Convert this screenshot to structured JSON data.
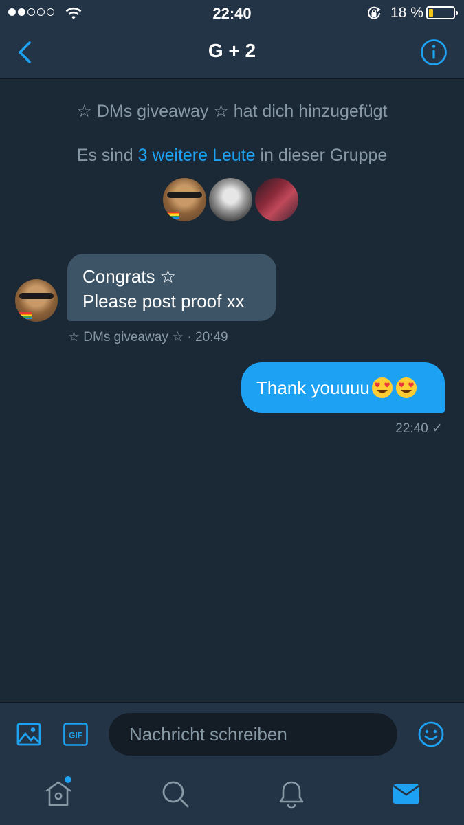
{
  "status_bar": {
    "time": "22:40",
    "battery_percent_label": "18 %",
    "battery_level": 0.18,
    "signal_bars_filled": 2,
    "signal_bars_total": 5
  },
  "nav": {
    "title": "G + 2",
    "back_icon": "chevron-left-icon",
    "info_icon": "info-icon"
  },
  "conversation": {
    "added_notice": "☆ DMs giveaway ☆ hat dich hinzugefügt",
    "group_info_prefix": "Es sind ",
    "group_info_link": "3 weitere Leute",
    "group_info_suffix": " in dieser Gruppe",
    "messages": [
      {
        "direction": "incoming",
        "lines": [
          "Congrats ☆",
          "Please post proof xx"
        ],
        "sender": "☆ DMs giveaway ☆",
        "time": "20:49",
        "meta": "☆ DMs giveaway ☆ · 20:49"
      },
      {
        "direction": "outgoing",
        "text": "Thank youuuu",
        "emoji": [
          "heart-eyes-emoji",
          "heart-eyes-emoji"
        ],
        "time": "22:40",
        "meta": "22:40 ✓"
      }
    ]
  },
  "composer": {
    "placeholder": "Nachricht schreiben",
    "value": "",
    "gif_label": "GIF"
  },
  "tabbar": {
    "items": [
      "home-icon",
      "search-icon",
      "bell-icon",
      "mail-icon"
    ],
    "active": "mail-icon"
  },
  "colors": {
    "accent": "#1da1f2",
    "background": "#1b2836",
    "bar": "#243447",
    "incoming_bubble": "#3d5466",
    "battery_fill": "#f5c518"
  }
}
